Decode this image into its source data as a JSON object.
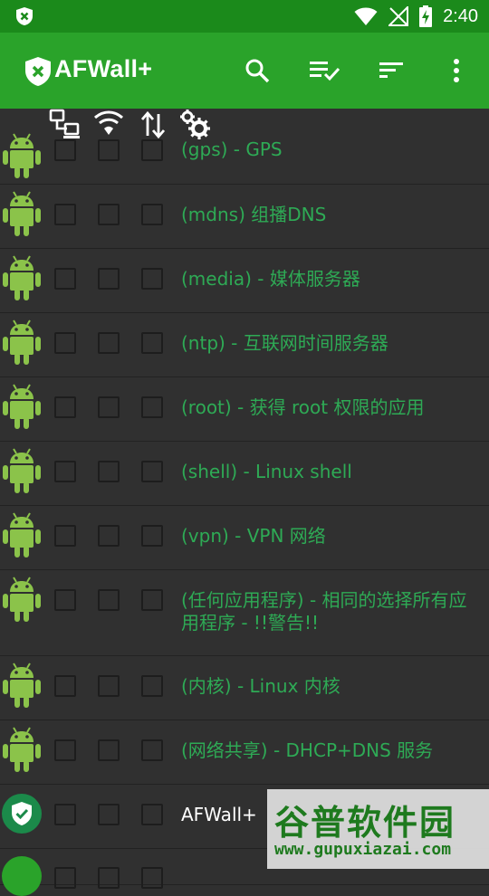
{
  "status_bar": {
    "time": "2:40"
  },
  "app": {
    "title": "AFWall+"
  },
  "rows": [
    {
      "label": "(gps) - GPS"
    },
    {
      "label": "(mdns) 组播DNS"
    },
    {
      "label": "(media) - 媒体服务器"
    },
    {
      "label": "(ntp) - 互联网时间服务器"
    },
    {
      "label": "(root) - 获得 root 权限的应用"
    },
    {
      "label": "(shell) - Linux shell"
    },
    {
      "label": "(vpn) - VPN 网络"
    },
    {
      "label": "(任何应用程序) - 相同的选择所有应用程序 - !!警告!!"
    },
    {
      "label": "(内核) - Linux 内核"
    },
    {
      "label": "(网络共享) - DHCP+DNS 服务"
    },
    {
      "label": "AFWall+"
    }
  ],
  "watermark": {
    "big": "谷普软件园",
    "small": "www.gupuxiazai.com"
  },
  "colors": {
    "status_bar": "#1b8a1b",
    "toolbar": "#2aa32a",
    "label_green": "#2eaa55",
    "android_green": "#8bc34a"
  }
}
